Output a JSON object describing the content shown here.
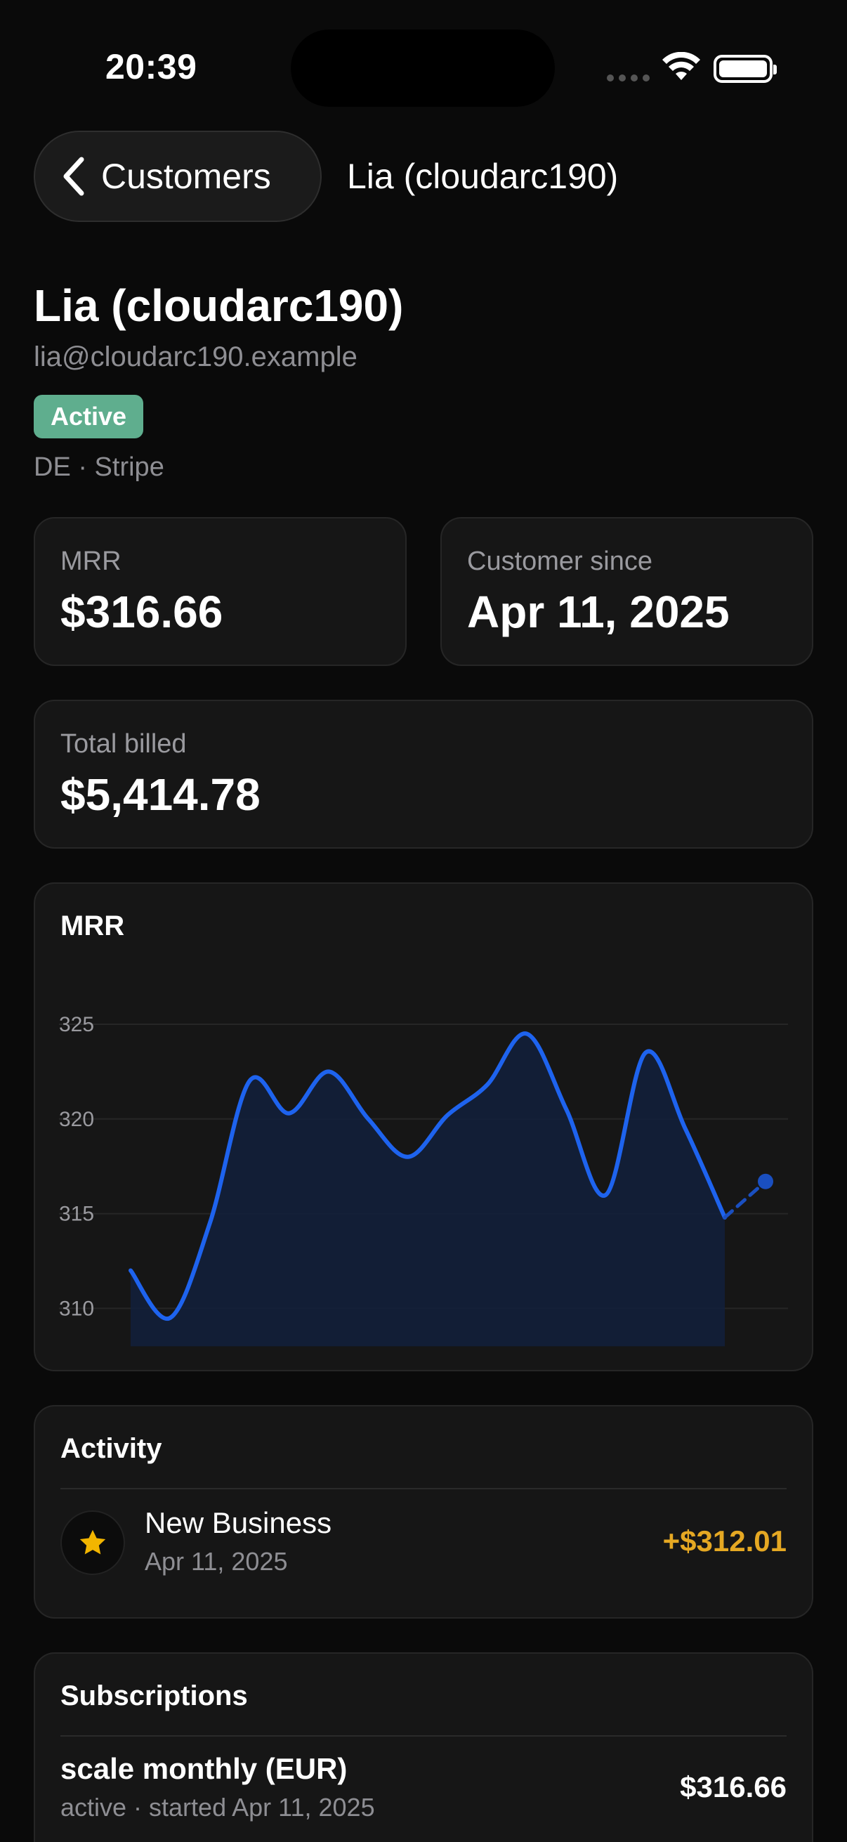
{
  "status_bar": {
    "time": "20:39"
  },
  "nav": {
    "back_label": "Customers",
    "title": "Lia (cloudarc190)"
  },
  "customer": {
    "name": "Lia (cloudarc190)",
    "email": "lia@cloudarc190.example",
    "status": "Active",
    "meta": "DE · Stripe"
  },
  "stats": {
    "mrr_label": "MRR",
    "mrr_value": "$316.66",
    "since_label": "Customer since",
    "since_value": "Apr 11, 2025",
    "billed_label": "Total billed",
    "billed_value": "$5,414.78"
  },
  "chart_data": {
    "type": "area",
    "title": "MRR",
    "xlabel": "",
    "ylabel": "",
    "yticks": [
      325,
      320,
      315,
      310
    ],
    "ylim": [
      308,
      326
    ],
    "grid": true,
    "line_color": "#1e63ee",
    "values": [
      312.0,
      309.5,
      314.5,
      322.0,
      320.3,
      322.5,
      320.0,
      318.0,
      320.2,
      321.8,
      324.5,
      320.5,
      316.0,
      323.5,
      319.5,
      314.8
    ],
    "projected": {
      "from": 314.8,
      "to": 316.7
    }
  },
  "activity": {
    "title": "Activity",
    "items": [
      {
        "icon": "star-icon",
        "title": "New Business",
        "date": "Apr 11, 2025",
        "amount": "+$312.01"
      }
    ]
  },
  "subscriptions": {
    "title": "Subscriptions",
    "items": [
      {
        "name": "scale monthly (EUR)",
        "meta": "active · started Apr 11, 2025",
        "amount": "$316.66"
      }
    ]
  },
  "colors": {
    "accent": "#1e63ee",
    "badge_active": "#5fae8e",
    "amount_positive": "#e5a823",
    "background": "#0a0a0a",
    "card": "#161616"
  }
}
